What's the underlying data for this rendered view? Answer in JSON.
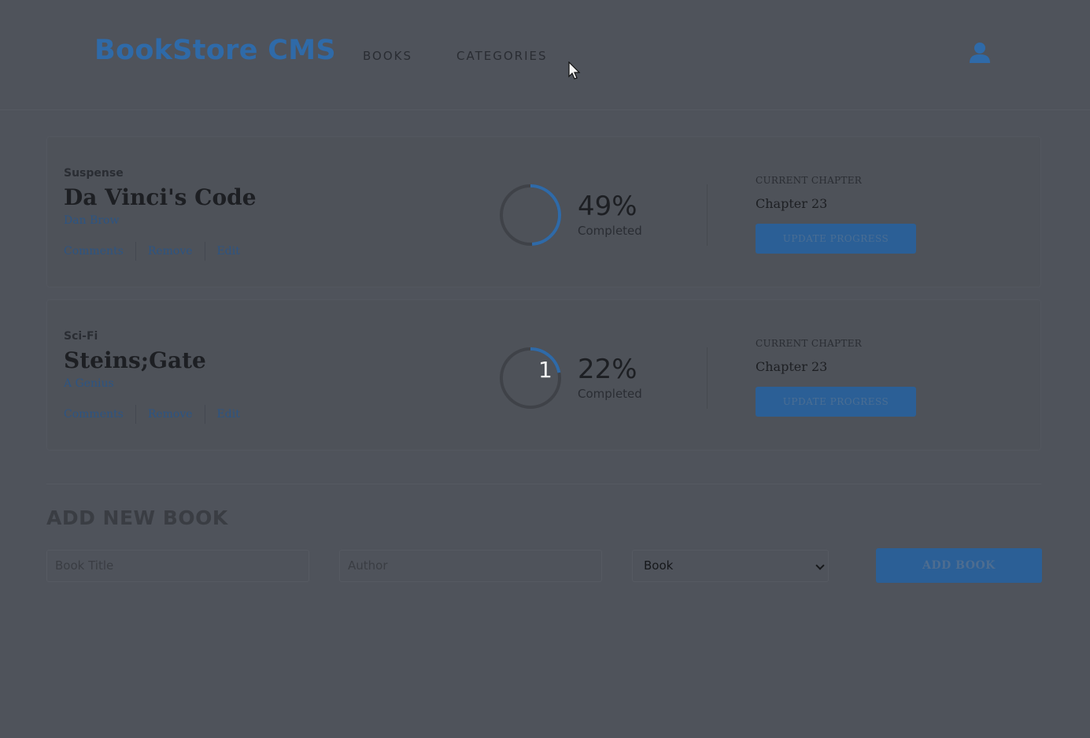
{
  "header": {
    "logo": "BookStore CMS",
    "nav": [
      "BOOKS",
      "CATEGORIES"
    ],
    "user_icon": "user-icon"
  },
  "books": [
    {
      "genre": "Suspense",
      "title": "Da Vinci's Code",
      "author": "Dan Brow",
      "actions": [
        "Comments",
        "Remove",
        "Edit"
      ],
      "progress": 0.49,
      "percent_text": "49%",
      "completed_label": "Completed",
      "chapter_label": "CURRENT CHAPTER",
      "chapter_value": "Chapter 23",
      "update_label": "UPDATE PROGRESS"
    },
    {
      "genre": "Sci-Fi",
      "title": "Steins;Gate",
      "author": "A Genius",
      "actions": [
        "Comments",
        "Remove",
        "Edit"
      ],
      "progress": 0.22,
      "percent_text": "22%",
      "ring_overlay": "1",
      "completed_label": "Completed",
      "chapter_label": "CURRENT CHAPTER",
      "chapter_value": "Chapter 23",
      "update_label": "UPDATE PROGRESS"
    }
  ],
  "add_book": {
    "heading": "ADD NEW BOOK",
    "title_placeholder": "Book Title",
    "author_placeholder": "Author",
    "category_selected": "Book",
    "submit_label": "ADD BOOK"
  },
  "colors": {
    "background": "#4f535b",
    "accent": "#2f6aa8",
    "button": "#2b5f96",
    "ring_track": "#3f4248"
  }
}
